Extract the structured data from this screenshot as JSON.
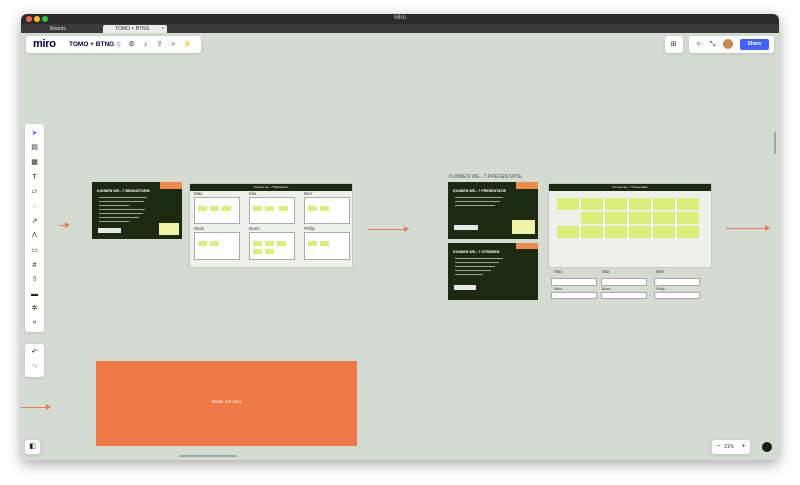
{
  "window": {
    "title": "Miro",
    "tabs": [
      {
        "label": "Boards",
        "active": false
      },
      {
        "label": "TOMO + BTNG",
        "active": true
      }
    ]
  },
  "toolbar": {
    "logo": "miro",
    "board_name": "TOMO + BTNG",
    "share_label": "Share",
    "icons": [
      "star-icon",
      "gear-icon",
      "bell-icon",
      "upload-icon",
      "search-icon",
      "magic-icon"
    ]
  },
  "zoom": {
    "level": "31%",
    "minus": "−",
    "plus": "+"
  },
  "canvas": {
    "brainstorm_card_title": "KUNNEN WE...? BRAINSTORM",
    "brainstorm_frame_header": "Kunnen we...? Brainstorm",
    "brainstorm_names": [
      "Max",
      "Mia",
      "Berr",
      "Niels",
      "Bram",
      "Philip"
    ],
    "presentatie_frame_label": "KUNNEN WE...? PRESENTATIE",
    "presentatie_card_title": "KUNNEN WE...? PRESENTATIE",
    "stemmen_card_title": "KUNNEN WE...? STEMMEN",
    "presentatie_frame_header": "Kunnen we...? Presentatie",
    "presentatie_names": [
      "Max",
      "Mia",
      "Berr",
      "Niels",
      "Bram",
      "Philip"
    ],
    "kunnen_we_note": "Kunnen we...",
    "break_label": "Break (15 min)"
  },
  "colors": {
    "canvas_bg": "#d4dcd2",
    "dark_card": "#1c2a12",
    "orange": "#f07a45",
    "sticky": "#d9ef7a",
    "accent": "#4262ff"
  }
}
